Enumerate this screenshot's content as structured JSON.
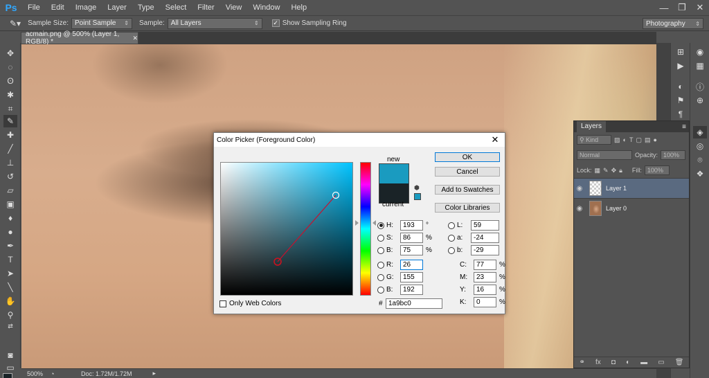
{
  "menubar": {
    "logo": "Ps",
    "items": [
      "File",
      "Edit",
      "Image",
      "Layer",
      "Type",
      "Select",
      "Filter",
      "View",
      "Window",
      "Help"
    ],
    "min": "—",
    "max": "❐",
    "close": "✕"
  },
  "options": {
    "sample_size_label": "Sample Size:",
    "sample_size_value": "Point Sample",
    "sample_label": "Sample:",
    "sample_value": "All Layers",
    "ring_label": "Show Sampling Ring",
    "workspace": "Photography"
  },
  "document": {
    "tab_title": "acmain.png @ 500% (Layer 1, RGB/8) *",
    "tab_close": "✕"
  },
  "status": {
    "zoom": "500%",
    "doc": "Doc: 1.72M/1.72M"
  },
  "colors": {
    "foreground": "#1a2327",
    "background": "#96785a",
    "new_color": "#1a9bc0",
    "current_color": "#1a2327"
  },
  "layers": {
    "tab": "Layers",
    "kind_label": "Kind",
    "blend_mode": "Normal",
    "opacity_label": "Opacity:",
    "opacity_value": "100%",
    "lock_label": "Lock:",
    "fill_label": "Fill:",
    "fill_value": "100%",
    "items": [
      {
        "name": "Layer 1",
        "selected": true
      },
      {
        "name": "Layer 0",
        "selected": false
      }
    ]
  },
  "dialog": {
    "title": "Color Picker (Foreground Color)",
    "new_label": "new",
    "current_label": "current",
    "ok": "OK",
    "cancel": "Cancel",
    "add_to_swatches": "Add to Swatches",
    "color_libraries": "Color Libraries",
    "only_web_colors": "Only Web Colors",
    "hash": "#",
    "hex": "1a9bc0",
    "hsb": {
      "h_label": "H:",
      "h": "193",
      "h_unit": "°",
      "s_label": "S:",
      "s": "86",
      "s_unit": "%",
      "b_label": "B:",
      "b": "75",
      "b_unit": "%"
    },
    "rgb": {
      "r_label": "R:",
      "r": "26",
      "g_label": "G:",
      "g": "155",
      "b_label": "B:",
      "b": "192"
    },
    "lab": {
      "l_label": "L:",
      "l": "59",
      "a_label": "a:",
      "a": "-24",
      "b_label": "b:",
      "b": "-29"
    },
    "cmyk": {
      "c_label": "C:",
      "c": "77",
      "c_unit": "%",
      "m_label": "M:",
      "m": "23",
      "m_unit": "%",
      "y_label": "Y:",
      "y": "16",
      "y_unit": "%",
      "k_label": "K:",
      "k": "0",
      "k_unit": "%"
    }
  }
}
